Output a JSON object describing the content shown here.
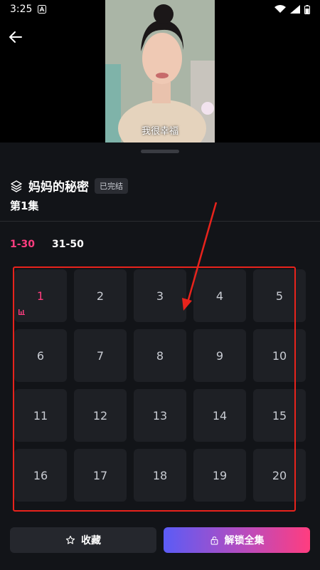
{
  "status_bar": {
    "time": "3:25"
  },
  "video": {
    "subtitle": "我很幸福"
  },
  "sheet": {
    "title": "妈妈的秘密",
    "status_badge": "已完结",
    "current_episode": "第1集",
    "range_tabs": [
      "1-30",
      "31-50"
    ],
    "episodes": [
      "1",
      "2",
      "3",
      "4",
      "5",
      "6",
      "7",
      "8",
      "9",
      "10",
      "11",
      "12",
      "13",
      "14",
      "15",
      "16",
      "17",
      "18",
      "19",
      "20"
    ],
    "playing_episode": "1"
  },
  "bottom_bar": {
    "collect_label": "收藏",
    "unlock_label": "解锁全集"
  },
  "colors": {
    "accent": "#ff3d7f",
    "highlight": "#e8231c",
    "background": "#121418",
    "cell": "#1e2025"
  }
}
